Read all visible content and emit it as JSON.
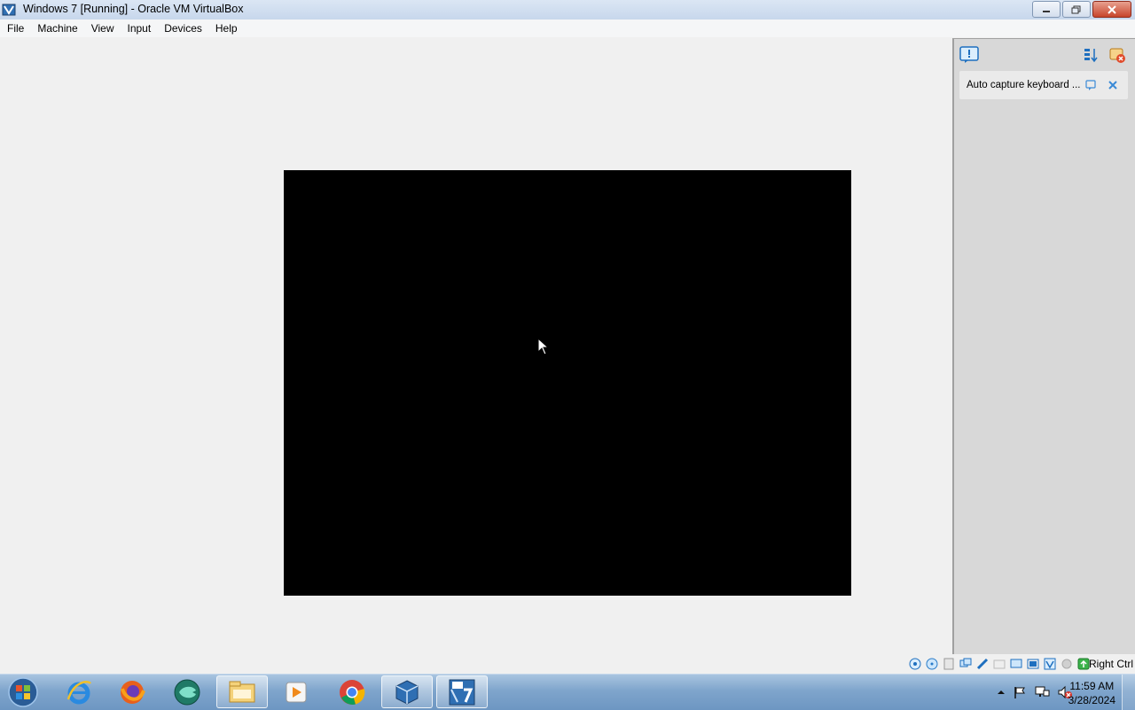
{
  "window": {
    "title": "Windows 7 [Running] - Oracle VM VirtualBox"
  },
  "menu": [
    "File",
    "Machine",
    "View",
    "Input",
    "Devices",
    "Help"
  ],
  "notification": {
    "text": "Auto capture keyboard ..."
  },
  "status": {
    "host_key": "Right Ctrl"
  },
  "clock": {
    "time": "11:59 AM",
    "date": "3/28/2024"
  },
  "taskbar": {
    "apps": [
      "internet-explorer-icon",
      "firefox-icon",
      "media-app-icon",
      "file-explorer-icon",
      "media-player-icon",
      "chrome-icon",
      "virtualbox-icon",
      "windows7-vm-icon"
    ]
  },
  "colors": {
    "vm_screen": "#000000",
    "taskbar": "#7fa5cc"
  }
}
